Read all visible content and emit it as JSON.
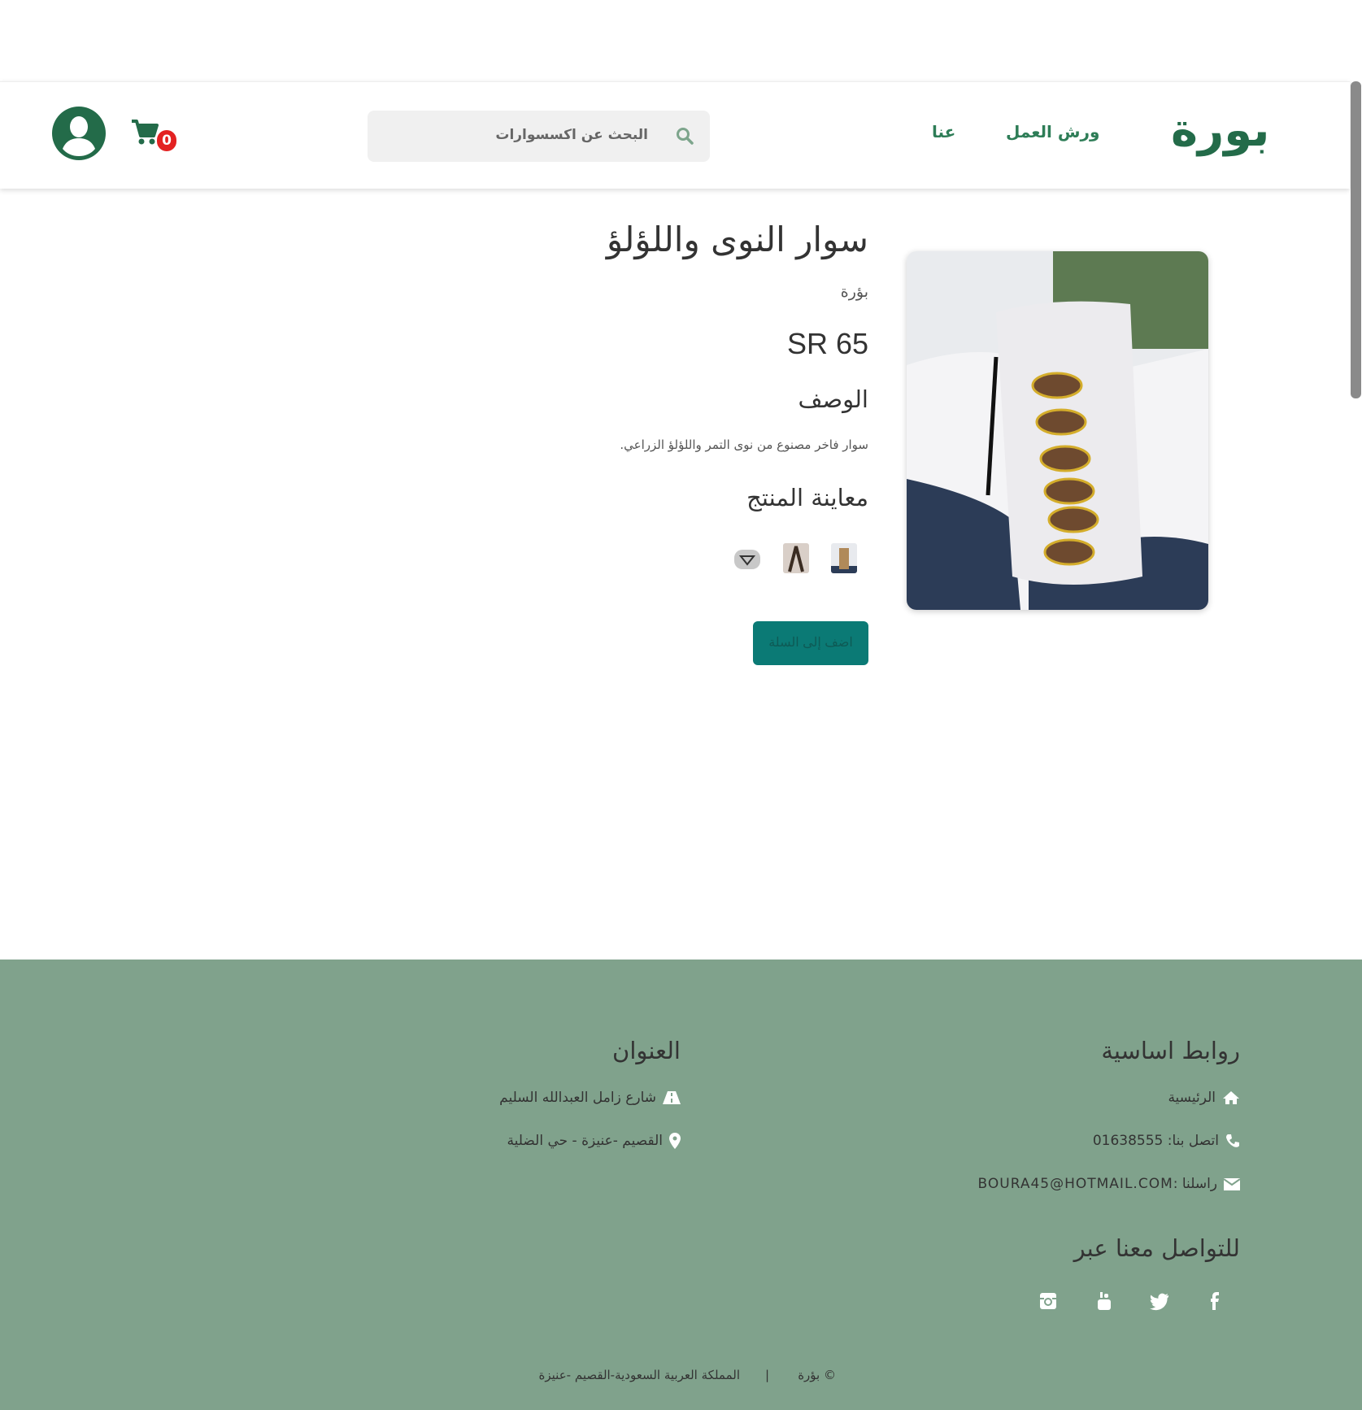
{
  "header": {
    "logo": "بورة",
    "nav": [
      {
        "label": "ورش العمل"
      },
      {
        "label": "عنا"
      }
    ],
    "search_placeholder": "البحث عن اكسسوارات",
    "cart_count": "0",
    "brand_color": "#236b49"
  },
  "product": {
    "title": "سوار النوى واللؤلؤ",
    "brand": "بؤرة",
    "price": "SR 65",
    "description_heading": "الوصف",
    "description": "سوار فاخر مصنوع من نوى التمر واللؤلؤ الزراعي.",
    "preview_heading": "معاينة المنتج",
    "add_to_cart": "اضف إلى السلة",
    "button_color": "#0b7a75"
  },
  "footer": {
    "links_heading": "روابط اساسية",
    "home": "الرئيسية",
    "phone": "اتصل بنا: 01638555",
    "email": "راسلنا :BOURA45@HOTMAIL.COM",
    "social_heading": "للتواصل معنا عبر",
    "address_heading": "العنوان",
    "street": "شارع زامل العبدالله السليم",
    "location": "القصيم -عنيزة - حي الضلية",
    "copyright_brand": "© بؤرة",
    "separator": "|",
    "copyright_location": "المملكة العربية السعودية-القصيم -عنيزة",
    "bg_color": "#80a28c"
  }
}
